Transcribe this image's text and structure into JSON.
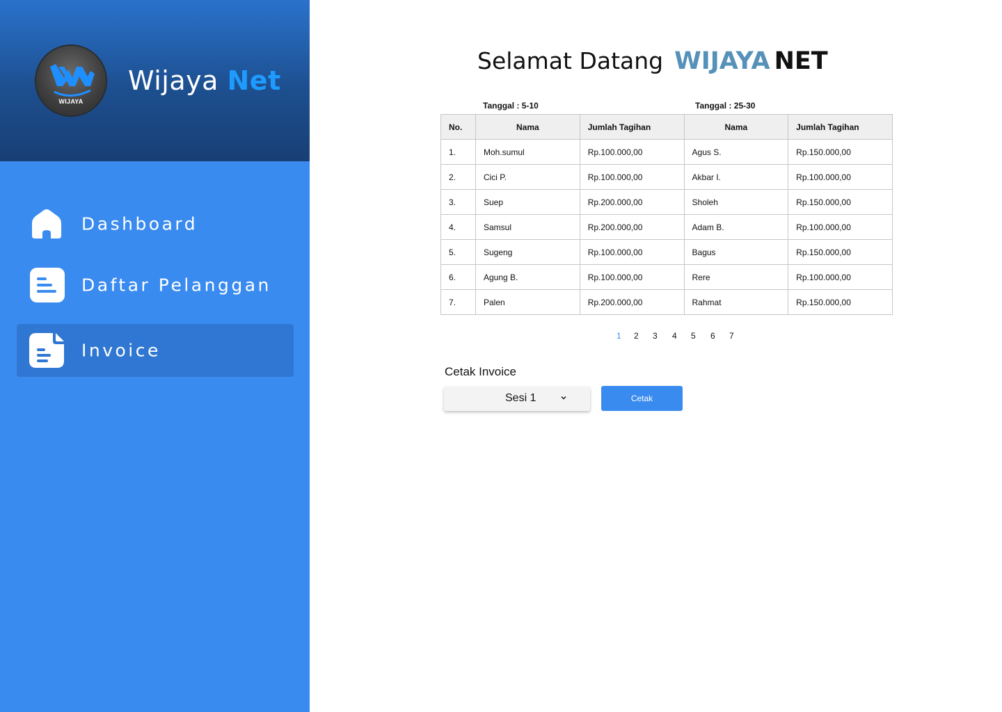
{
  "brand": {
    "logo_text": "WIJAYA",
    "name_part1": "Wijaya ",
    "name_part2": "Net"
  },
  "sidebar": {
    "items": [
      {
        "label": "Dashboard",
        "icon": "home-icon",
        "active": false
      },
      {
        "label": "Daftar Pelanggan",
        "icon": "list-document-icon",
        "active": false
      },
      {
        "label": "Invoice",
        "icon": "invoice-document-icon",
        "active": true
      }
    ]
  },
  "header": {
    "greeting": "Selamat Datang",
    "brand_part1": "WIJAYA",
    "brand_part2": "NET"
  },
  "table": {
    "group_labels": [
      "Tanggal : 5-10",
      "Tanggal : 25-30"
    ],
    "columns": [
      "No.",
      "Nama",
      "Jumlah Tagihan",
      "Nama",
      "Jumlah Tagihan"
    ],
    "rows": [
      [
        "1.",
        "Moh.sumul",
        "Rp.100.000,00",
        "Agus S.",
        "Rp.150.000,00"
      ],
      [
        "2.",
        "Cici P.",
        "Rp.100.000,00",
        "Akbar I.",
        "Rp.100.000,00"
      ],
      [
        "3.",
        "Suep",
        "Rp.200.000,00",
        "Sholeh",
        "Rp.150.000,00"
      ],
      [
        "4.",
        "Samsul",
        "Rp.200.000,00",
        "Adam B.",
        "Rp.100.000,00"
      ],
      [
        "5.",
        "Sugeng",
        "Rp.100.000,00",
        "Bagus",
        "Rp.150.000,00"
      ],
      [
        "6.",
        "Agung B.",
        "Rp.100.000,00",
        "Rere",
        "Rp.100.000,00"
      ],
      [
        "7.",
        "Palen",
        "Rp.200.000,00",
        "Rahmat",
        "Rp.150.000,00"
      ]
    ]
  },
  "pagination": {
    "pages": [
      "1",
      "2",
      "3",
      "4",
      "5",
      "6",
      "7"
    ],
    "current": "1"
  },
  "invoice": {
    "title": "Cetak Invoice",
    "session_selected": "Sesi 1",
    "print_label": "Cetak"
  },
  "colors": {
    "sidebar": "#3a8bef",
    "active_item": "#2f77d2",
    "brand_accent": "#1e9bff",
    "header_accent": "#5591b8"
  }
}
